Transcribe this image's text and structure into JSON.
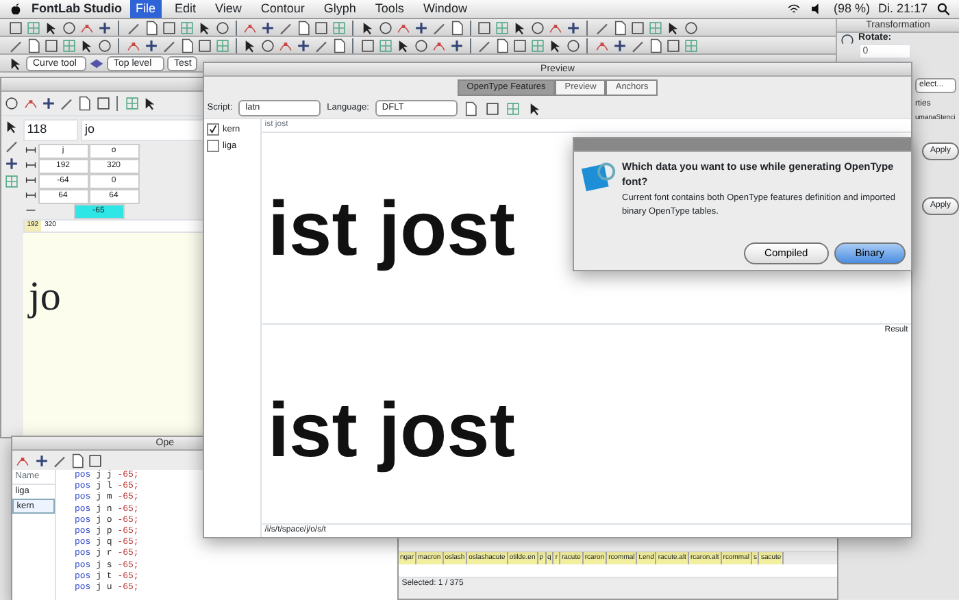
{
  "menubar": {
    "app": "FontLab Studio",
    "menus": [
      {
        "label": "File",
        "selected": true
      },
      {
        "label": "Edit",
        "selected": false
      },
      {
        "label": "View",
        "selected": false
      },
      {
        "label": "Contour",
        "selected": false
      },
      {
        "label": "Glyph",
        "selected": false
      },
      {
        "label": "Tools",
        "selected": false
      },
      {
        "label": "Window",
        "selected": false
      }
    ],
    "battery": "(98 %)",
    "clock": "Di. 21:17"
  },
  "toolbar": {
    "tool": "Curve tool",
    "layer": "Top level",
    "field": "Test"
  },
  "transformation": {
    "title": "Transformation",
    "rotate_label": "Rotate:",
    "rotate_value": "0",
    "select": "elect...",
    "properties": "rties",
    "font_name": "umanaStenci",
    "apply": [
      "Apply",
      "Apply"
    ]
  },
  "metrics": {
    "size": "118",
    "text": "jo",
    "rows": [
      [
        "j",
        "o"
      ],
      [
        "192",
        "320"
      ],
      [
        "-64",
        "0"
      ],
      [
        "64",
        "64"
      ]
    ],
    "kern": "-65",
    "ruler": [
      "192",
      "320"
    ],
    "sample": "jo"
  },
  "preview": {
    "title": "Preview",
    "tabs": [
      {
        "label": "OpenType Features",
        "selected": true
      },
      {
        "label": "Preview",
        "selected": false
      },
      {
        "label": "Anchors",
        "selected": false
      }
    ],
    "script_label": "Script:",
    "script": "latn",
    "language_label": "Language:",
    "language": "DFLT",
    "features": [
      {
        "tag": "kern",
        "checked": true
      },
      {
        "tag": "liga",
        "checked": false
      }
    ],
    "input": "ist jost",
    "sample_top": "ist jost",
    "result_label": "Result",
    "sample_bottom": "ist jost",
    "glyph_string": "/i/s/t/space/j/o/s/t"
  },
  "dialog": {
    "heading": "Which data you want to use while generating OpenType font?",
    "body": "Current font contains both OpenType features definition and imported binary OpenType tables.",
    "buttons": [
      {
        "label": "Compiled",
        "default": false
      },
      {
        "label": "Binary",
        "default": true
      }
    ]
  },
  "opentype_panel": {
    "title": "Ope",
    "column": "Name",
    "features": [
      {
        "name": "liga",
        "selected": false
      },
      {
        "name": "kern",
        "selected": true
      }
    ],
    "code": [
      {
        "keyword": "pos",
        "glyphs": "j j",
        "value": "-65;"
      },
      {
        "keyword": "pos",
        "glyphs": "j l",
        "value": "-65;"
      },
      {
        "keyword": "pos",
        "glyphs": "j m",
        "value": "-65;"
      },
      {
        "keyword": "pos",
        "glyphs": "j n",
        "value": "-65;"
      },
      {
        "keyword": "pos",
        "glyphs": "j o",
        "value": "-65;"
      },
      {
        "keyword": "pos",
        "glyphs": "j p",
        "value": "-65;"
      },
      {
        "keyword": "pos",
        "glyphs": "j q",
        "value": "-65;"
      },
      {
        "keyword": "pos",
        "glyphs": "j r",
        "value": "-65;"
      },
      {
        "keyword": "pos",
        "glyphs": "j s",
        "value": "-65;"
      },
      {
        "keyword": "pos",
        "glyphs": "j t",
        "value": "-65;"
      },
      {
        "keyword": "pos",
        "glyphs": "j u",
        "value": "-65;"
      }
    ]
  },
  "glyph_table": {
    "names": [
      {
        "name": "ngar",
        "selected": false
      },
      {
        "name": "macron",
        "selected": false
      },
      {
        "name": "oslash",
        "selected": false
      },
      {
        "name": "oslashacute",
        "selected": false
      },
      {
        "name": "otilde.en",
        "selected": false
      },
      {
        "name": "p",
        "selected": false
      },
      {
        "name": "q",
        "selected": false
      },
      {
        "name": "r",
        "selected": false
      },
      {
        "name": "racute",
        "selected": false
      },
      {
        "name": "rcaron",
        "selected": false
      },
      {
        "name": "rcommal",
        "selected": false
      },
      {
        "name": "t.end",
        "selected": false
      },
      {
        "name": "racute.alt",
        "selected": false
      },
      {
        "name": "rcaron.alt",
        "selected": false
      },
      {
        "name": "rcommal",
        "selected": false
      },
      {
        "name": "s",
        "selected": false
      },
      {
        "name": "sacute",
        "selected": false
      }
    ],
    "status": "Selected: 1 / 375"
  }
}
